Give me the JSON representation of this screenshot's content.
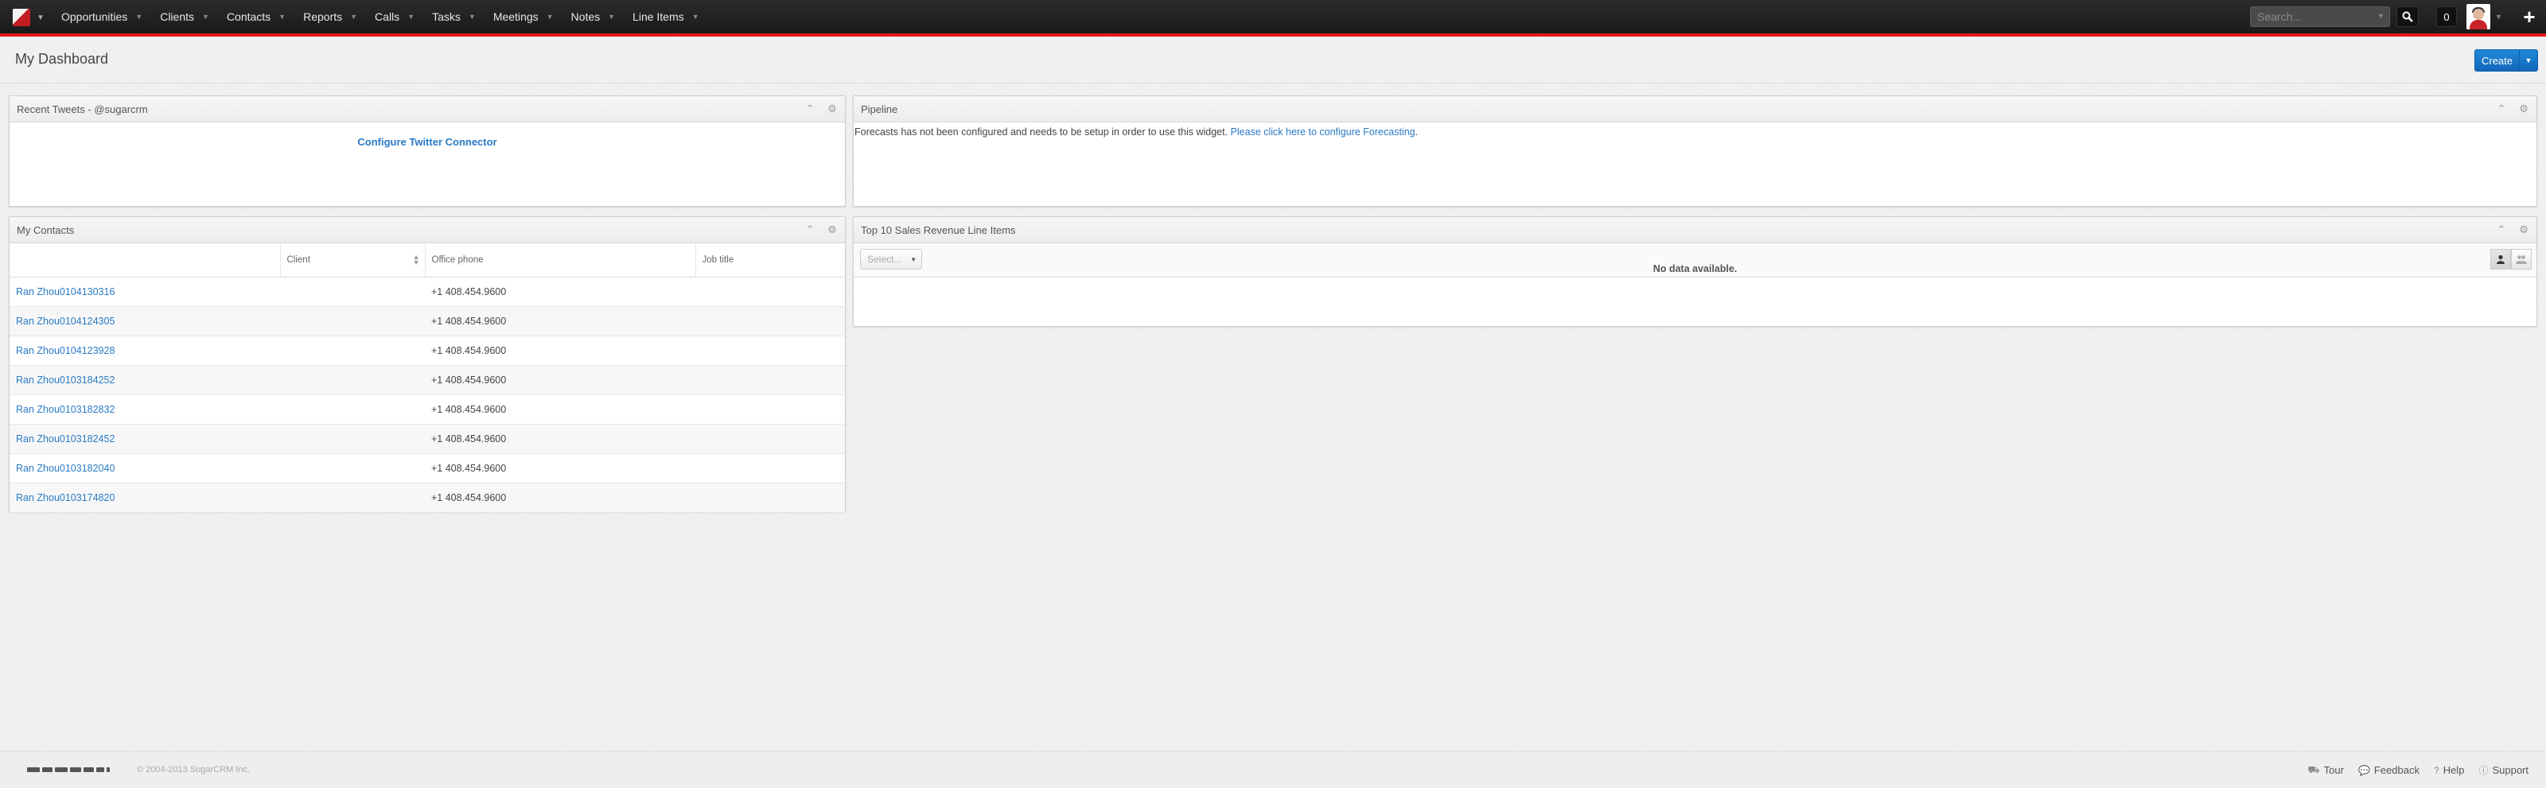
{
  "nav": {
    "items": [
      {
        "label": "Opportunities"
      },
      {
        "label": "Clients"
      },
      {
        "label": "Contacts"
      },
      {
        "label": "Reports"
      },
      {
        "label": "Calls"
      },
      {
        "label": "Tasks"
      },
      {
        "label": "Meetings"
      },
      {
        "label": "Notes"
      },
      {
        "label": "Line Items"
      }
    ],
    "search_placeholder": "Search...",
    "notification_count": "0"
  },
  "header": {
    "title": "My Dashboard",
    "create_label": "Create"
  },
  "dashlets": {
    "tweets": {
      "title": "Recent Tweets - @sugarcrm",
      "link": "Configure Twitter Connector"
    },
    "pipeline": {
      "title": "Pipeline",
      "message": "Forecasts has not been configured and needs to be setup in order to use this widget.",
      "link": "Please click here to configure Forecasting",
      "period": "."
    },
    "contacts": {
      "title": "My Contacts",
      "columns": [
        "",
        "Client",
        "Office phone",
        "Job title"
      ],
      "rows": [
        {
          "name": "Ran Zhou0104130316",
          "client": "",
          "phone": "+1 408.454.9600",
          "title": ""
        },
        {
          "name": "Ran Zhou0104124305",
          "client": "",
          "phone": "+1 408.454.9600",
          "title": ""
        },
        {
          "name": "Ran Zhou0104123928",
          "client": "",
          "phone": "+1 408.454.9600",
          "title": ""
        },
        {
          "name": "Ran Zhou0103184252",
          "client": "",
          "phone": "+1 408.454.9600",
          "title": ""
        },
        {
          "name": "Ran Zhou0103182832",
          "client": "",
          "phone": "+1 408.454.9600",
          "title": ""
        },
        {
          "name": "Ran Zhou0103182452",
          "client": "",
          "phone": "+1 408.454.9600",
          "title": ""
        },
        {
          "name": "Ran Zhou0103182040",
          "client": "",
          "phone": "+1 408.454.9600",
          "title": ""
        },
        {
          "name": "Ran Zhou0103174820",
          "client": "",
          "phone": "+1 408.454.9600",
          "title": ""
        }
      ]
    },
    "revenue": {
      "title": "Top 10 Sales Revenue Line Items",
      "select_placeholder": "Select...",
      "no_data": "No data available."
    }
  },
  "footer": {
    "copyright": "© 2004-2013 SugarCRM Inc.",
    "links": [
      {
        "label": "Tour",
        "icon": "road-icon"
      },
      {
        "label": "Feedback",
        "icon": "comment-icon"
      },
      {
        "label": "Help",
        "icon": "question-icon"
      },
      {
        "label": "Support",
        "icon": "info-icon"
      }
    ]
  },
  "colors": {
    "accent": "#e61718",
    "link": "#2a7ac4",
    "create_button": "#1a7bd0"
  }
}
